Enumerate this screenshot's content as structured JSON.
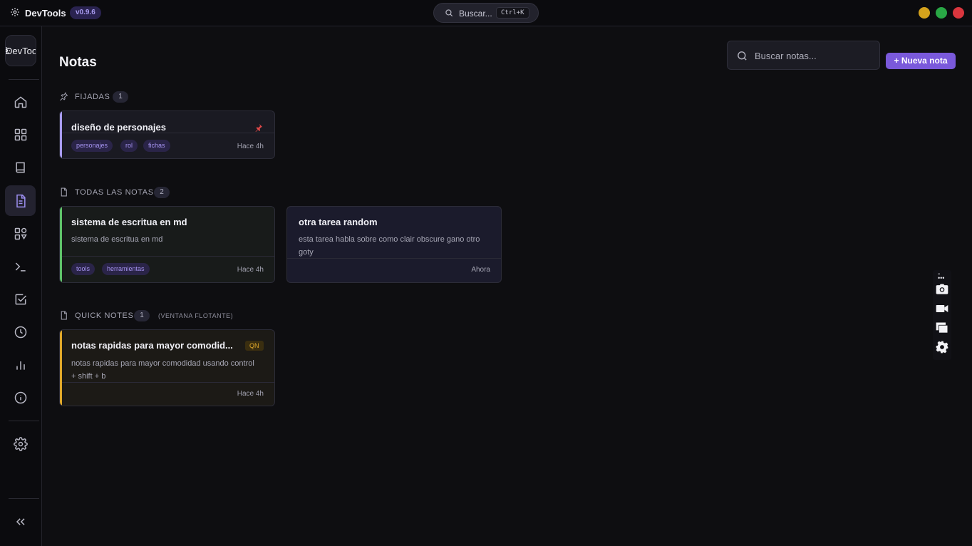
{
  "app": {
    "title": "DevTools",
    "version": "v0.9.6",
    "search_label": "Buscar...",
    "search_shortcut": "Ctrl+K"
  },
  "sidebar": {
    "brand_label": "DevTools",
    "items": [
      {
        "name": "home",
        "icon": "home-icon"
      },
      {
        "name": "dashboard",
        "icon": "grid-icon"
      },
      {
        "name": "library",
        "icon": "book-icon"
      },
      {
        "name": "notes",
        "icon": "file-text-icon",
        "active": true
      },
      {
        "name": "components",
        "icon": "shapes-icon"
      },
      {
        "name": "terminal",
        "icon": "terminal-icon"
      },
      {
        "name": "tasks",
        "icon": "checkbox-icon"
      },
      {
        "name": "history",
        "icon": "clock-icon"
      },
      {
        "name": "stats",
        "icon": "bar-chart-icon"
      },
      {
        "name": "info",
        "icon": "info-icon"
      },
      {
        "name": "settings",
        "icon": "gear-icon"
      }
    ],
    "collapse_icon": "chevrons-left-icon"
  },
  "page": {
    "title": "Notas",
    "search_placeholder": "Buscar notas...",
    "new_button": "+ Nueva nota"
  },
  "sections": {
    "pinned": {
      "title": "FIJADAS",
      "count": "1"
    },
    "all": {
      "title": "TODAS LAS NOTAS",
      "count": "2"
    },
    "quick": {
      "title": "QUICK NOTES",
      "count": "1",
      "extra": "(VENTANA FLOTANTE)"
    }
  },
  "notes": {
    "pinned": [
      {
        "title": "diseño de personajes",
        "tags": [
          "personajes",
          "rol",
          "fichas"
        ],
        "time": "Hace 4h",
        "accent": "#a99cf0"
      }
    ],
    "all": [
      {
        "title": "sistema de escritua en md",
        "body": "sistema de escritua en md",
        "tags": [
          "tools",
          "herramientas"
        ],
        "time": "Hace 4h",
        "accent": "#5fc46a"
      },
      {
        "title": "otra tarea random",
        "body": "esta tarea habla sobre como clair obscure gano otro goty",
        "time": "Ahora"
      }
    ],
    "quick": [
      {
        "title": "notas rapidas para mayor comodid...",
        "badge": "QN",
        "body": "notas rapidas para mayor comodidad usando control + shift + b",
        "time": "Hace 4h",
        "accent": "#e0a82a"
      }
    ]
  },
  "floating_toolbar": {
    "handle": "◦ •••",
    "buttons": [
      "camera-icon",
      "video-camera-icon",
      "window-stack-icon",
      "gear-icon"
    ]
  },
  "colors": {
    "accent": "#7a59db",
    "background": "#0e0e11",
    "pinned_accent": "#a99cf0",
    "note_green": "#5fc46a",
    "quick_note_yellow": "#e0a82a"
  }
}
